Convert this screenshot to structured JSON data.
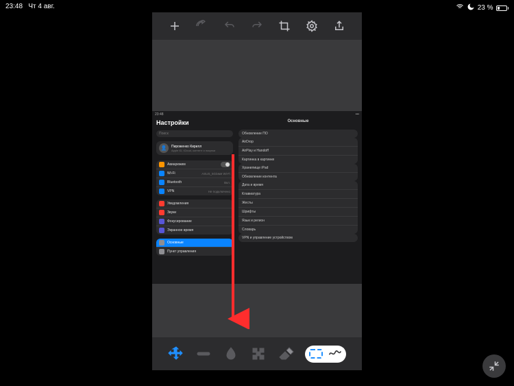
{
  "ipad_status": {
    "time": "23:48",
    "date": "Чт 4 авг.",
    "battery_pct": "23 %",
    "battery_fill_pct": 23
  },
  "toolbar_top": {
    "add": "add",
    "back": "back",
    "undo": "undo",
    "redo": "redo",
    "crop": "crop",
    "settings": "settings",
    "share": "share"
  },
  "toolbar_bottom": {
    "move": "move",
    "line": "line",
    "blur": "blur",
    "pixelate": "pixelate",
    "eraser": "eraser",
    "select_rect": "select-rect",
    "select_free": "select-free"
  },
  "screenshot_content": {
    "status_time": "23:48",
    "title": "Настройки",
    "search_placeholder": "Поиск",
    "profile": {
      "name": "Пироженко Кирилл",
      "subtitle": "Apple ID, iCloud, контент и покупки"
    },
    "sidebar_groups": [
      {
        "rows": [
          {
            "icon": "#ff9500",
            "label": "Авиарежим",
            "toggle": true
          },
          {
            "icon": "#0a84ff",
            "label": "Wi-Fi",
            "detail": "ASUS_5G/имя Wi-Fi"
          },
          {
            "icon": "#0a84ff",
            "label": "Bluetooth",
            "detail": "Вкл."
          },
          {
            "icon": "#0a84ff",
            "label": "VPN",
            "detail": "Не подключено"
          }
        ]
      },
      {
        "rows": [
          {
            "icon": "#ff3b30",
            "label": "Уведомления"
          },
          {
            "icon": "#ff3b30",
            "label": "Звуки"
          },
          {
            "icon": "#5856d6",
            "label": "Фокусирование"
          },
          {
            "icon": "#5856d6",
            "label": "Экранное время"
          }
        ]
      },
      {
        "rows": [
          {
            "icon": "#8e8e93",
            "label": "Основные",
            "active": true
          },
          {
            "icon": "#8e8e93",
            "label": "Пункт управления"
          }
        ]
      }
    ],
    "detail_title": "Основные",
    "detail_groups": [
      [
        "Обновление ПО"
      ],
      [
        "AirDrop",
        "AirPlay и Handoff",
        "Картинка в картинке"
      ],
      [
        "Хранилище iPad",
        "Обновление контента"
      ],
      [
        "Дата и время",
        "Клавиатура",
        "Жесты",
        "Шрифты",
        "Язык и регион",
        "Словарь"
      ],
      [
        "VPN и управление устройством"
      ]
    ]
  },
  "fab": {
    "name": "minimize"
  }
}
